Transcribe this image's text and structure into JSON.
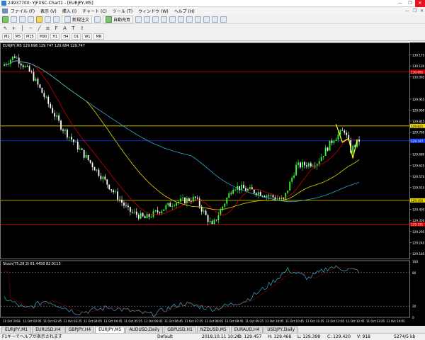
{
  "window": {
    "title": "24937700: YJFXSC-Chart1 - [EURJPY,M5]",
    "buttons": [
      "—",
      "❐",
      "✕"
    ]
  },
  "menu": {
    "items": [
      "ファイル (F)",
      "表示 (V)",
      "挿入 (I)",
      "チャート (C)",
      "ツール (T)",
      "ウィンドウ (W)",
      "ヘルプ (H)"
    ],
    "mdi": [
      "—",
      "❐",
      "✕"
    ]
  },
  "toolbar": {
    "new_order": "新規注文",
    "auto_trade": "自動売買"
  },
  "timeframes": [
    "M1",
    "M5",
    "M15",
    "M30",
    "H1",
    "H4",
    "D1",
    "W1",
    "MN"
  ],
  "chart": {
    "header": "EURJPY,M5  129.698 129.747 129.684 129.747",
    "osc_header": "Stoch(75,28,3) 81.4458 82.0113",
    "price_labels": [
      "130.175",
      "130.120",
      "130.065",
      "129.955",
      "129.900",
      "129.845",
      "129.790",
      "129.680",
      "129.625",
      "129.570",
      "129.515",
      "129.405",
      "129.350",
      "129.295",
      "129.240",
      "129.185"
    ],
    "marked_levels": [
      {
        "value": "130.091",
        "color": "#cc0000"
      },
      {
        "value": "129.821",
        "color": "#e8d400"
      },
      {
        "value": "129.747",
        "color": "#1a3cff"
      },
      {
        "value": "129.450",
        "color": "#e8d400"
      },
      {
        "value": "129.331",
        "color": "#cc0000"
      }
    ],
    "osc_labels": [
      "100",
      "80",
      "20",
      "0"
    ],
    "time_labels": [
      "11 Oct 2018",
      "11 Oct 02:05",
      "11 Oct 02:45",
      "11 Oct 03:25",
      "11 Oct 04:05",
      "11 Oct 04:45",
      "11 Oct 05:25",
      "11 Oct 06:05",
      "11 Oct 06:45",
      "11 Oct 07:25",
      "11 Oct 08:05",
      "11 Oct 08:45",
      "11 Oct 09:25",
      "11 Oct 10:05",
      "11 Oct 10:45",
      "11 Oct 11:25",
      "11 Oct 12:05",
      "11 Oct 12:45",
      "11 Oct 13:25",
      "11 Oct 14:05"
    ]
  },
  "tabs": [
    "EURJPY,M1",
    "EURUSD,H4",
    "GBPJPY,H4",
    "EURJPY,M5",
    "AUDUSD,Daily",
    "GBPUSD,H1",
    "NZDUSD,M5",
    "EURAUD,H4",
    "USDJPY,Daily"
  ],
  "active_tab_index": 3,
  "status": {
    "help": "F1キーでヘルプが表示されます",
    "profile": "Default",
    "datetime": "2018.10.11 10:20",
    "open": "O: 129.457",
    "high": "H: 129.468",
    "low": "L: 129.398",
    "close": "C: 129.420",
    "volume": "V: 918",
    "traffic": "5274/5 kb"
  },
  "colors": {
    "chart_bg": "#000000",
    "bull": "#33ff33",
    "bear": "#ffffff",
    "ma_fast": "#cc0000",
    "ma_mid": "#e8d400",
    "ma_slow": "#33aacc",
    "osc": "#3fa9c9"
  }
}
